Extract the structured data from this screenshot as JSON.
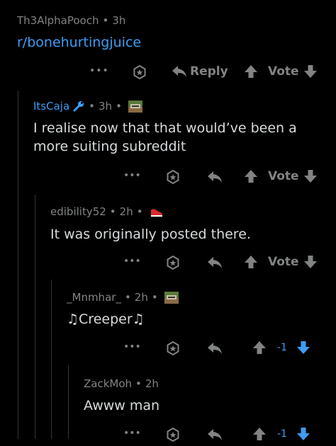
{
  "comments": [
    {
      "author": "Th3AlphaPooch",
      "time": "3h",
      "body": "r/bonehurtingjuice",
      "actions": {
        "more": "•••",
        "reply": "Reply",
        "vote": "Vote"
      }
    },
    {
      "author": "ItsCaja",
      "time": "3h",
      "body_lines": [
        "I realise now that that would’ve been a",
        "more suiting subreddit"
      ],
      "actions": {
        "more": "•••",
        "vote": "Vote"
      }
    },
    {
      "author": "edibility52",
      "time": "2h",
      "body": "It was originally posted there.",
      "actions": {
        "more": "•••",
        "vote": "Vote"
      }
    },
    {
      "author": "_Mnmhar_",
      "time": "2h",
      "body": "♫Creeper♫",
      "actions": {
        "more": "•••",
        "score": "-1"
      }
    },
    {
      "author": "ZackMoh",
      "time": "2h",
      "body": "Awww man",
      "actions": {
        "more": "•••",
        "score": "-1"
      }
    }
  ],
  "separator": "•",
  "colors": {
    "background": "#000000",
    "text": "#d7dadc",
    "muted": "#818384",
    "link": "#3d9df3",
    "thread_line": "#343536"
  },
  "icons": [
    "award-icon",
    "reply-arrow-icon",
    "upvote-icon",
    "downvote-icon",
    "more-icon",
    "wrench-flair-icon",
    "creeper-flair-icon",
    "shoe-flair-icon"
  ]
}
